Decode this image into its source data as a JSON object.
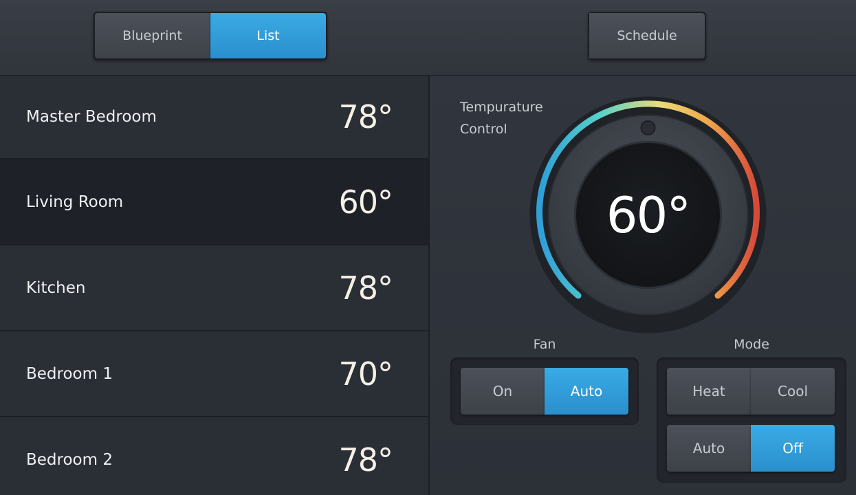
{
  "header": {
    "view_toggle": [
      {
        "label": "Blueprint",
        "active": false
      },
      {
        "label": "List",
        "active": true
      }
    ],
    "schedule_label": "Schedule"
  },
  "rooms": [
    {
      "name": "Master Bedroom",
      "temp": "78°",
      "selected": false
    },
    {
      "name": "Living Room",
      "temp": "60°",
      "selected": true
    },
    {
      "name": "Kitchen",
      "temp": "78°",
      "selected": false
    },
    {
      "name": "Bedroom 1",
      "temp": "70°",
      "selected": false
    },
    {
      "name": "Bedroom 2",
      "temp": "78°",
      "selected": false
    }
  ],
  "temperature_control": {
    "label_line1": "Tempurature",
    "label_line2": "Control",
    "value": "60°",
    "gradient_colors": [
      "#2f9fd8",
      "#58d1c9",
      "#e8dc78",
      "#f0a64a",
      "#d6493a"
    ]
  },
  "fan": {
    "label": "Fan",
    "options": [
      {
        "label": "On",
        "active": false
      },
      {
        "label": "Auto",
        "active": true
      }
    ]
  },
  "mode": {
    "label": "Mode",
    "options": [
      {
        "label": "Heat",
        "active": false
      },
      {
        "label": "Cool",
        "active": false
      },
      {
        "label": "Auto",
        "active": false
      },
      {
        "label": "Off",
        "active": true
      }
    ]
  },
  "colors": {
    "accent": "#2f9bd6",
    "background": "#2b2f36",
    "selected_row": "#1e2127"
  }
}
